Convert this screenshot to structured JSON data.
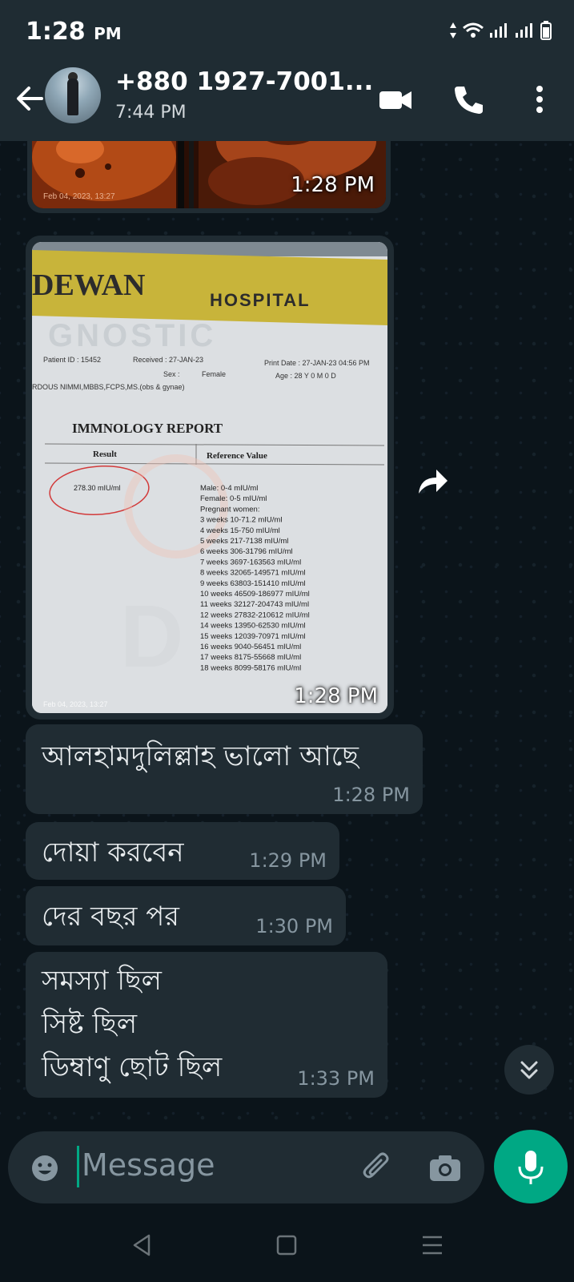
{
  "status_bar": {
    "time": "1:28",
    "ampm": "PM"
  },
  "header": {
    "contact_name": "+880 1927-7001...",
    "subtitle": "7:44 PM"
  },
  "messages": [
    {
      "type": "image",
      "time": "1:28 PM",
      "overlay_date": "Feb 04, 2023, 13:27"
    },
    {
      "type": "image",
      "time": "1:28 PM",
      "document": {
        "hospital_name_1": "DEWAN",
        "hospital_name_2": "HOSPITAL",
        "watermark": "GNOSTIC",
        "patient_id": "Patient ID : 15452",
        "received": "Received : 27-JAN-23",
        "print_date": "Print Date : 27-JAN-23 04:56 PM",
        "sex_label": "Sex  :",
        "sex_value": "Female",
        "age": "Age :  28 Y 0 M 0 D",
        "doctor": "RDOUS NIMMI,MBBS,FCPS,MS.(obs & gynae)",
        "report_title": "IMMNOLOGY REPORT",
        "col_result": "Result",
        "col_reference": "Reference Value",
        "result_value": "278.30  mIU/ml",
        "ref_lines": [
          "Male:        0-4 mIU/ml",
          "Female:     0-5 mIU/ml",
          "Pregnant women:",
          "3 weeks     10-71.2 mIU/ml",
          "4 weeks     15-750 mIU/ml",
          "5 weeks     217-7138 mIU/ml",
          "6 weeks     306-31796 mIU/ml",
          "7 weeks     3697-163563 mIU/ml",
          "8 weeks     32065-149571 mIU/ml",
          "9 weeks     63803-151410 mIU/ml",
          "10 weeks   46509-186977 mIU/ml",
          "11 weeks   32127-204743 mIU/ml",
          "12 weeks   27832-210612 mIU/ml",
          "14 weeks   13950-62530 mIU/ml",
          "15 weeks   12039-70971 mIU/ml",
          "16 weeks    9040-56451 mIU/ml",
          "17 weeks    8175-55668 mIU/ml",
          "18 weeks    8099-58176 mIU/ml"
        ],
        "overlay_date": "Feb 04, 2023, 13:27"
      }
    },
    {
      "type": "text",
      "lines": [
        "আলহামদুলিল্লাহ ভালো আছে"
      ],
      "time": "1:28 PM"
    },
    {
      "type": "text",
      "lines": [
        "দোয়া করবেন"
      ],
      "time": "1:29 PM"
    },
    {
      "type": "text",
      "lines": [
        "দের বছর  পর"
      ],
      "time": "1:30 PM"
    },
    {
      "type": "text",
      "lines": [
        "সমস্যা ছিল",
        " সিষ্ট ছিল",
        "ডিম্বাণু  ছোট ছিল"
      ],
      "time": "1:33 PM"
    }
  ],
  "input": {
    "placeholder": "Message"
  },
  "colors": {
    "bubble": "#202c33",
    "background": "#0b141a",
    "accent": "#00a884",
    "bar": "#1f2c33"
  }
}
